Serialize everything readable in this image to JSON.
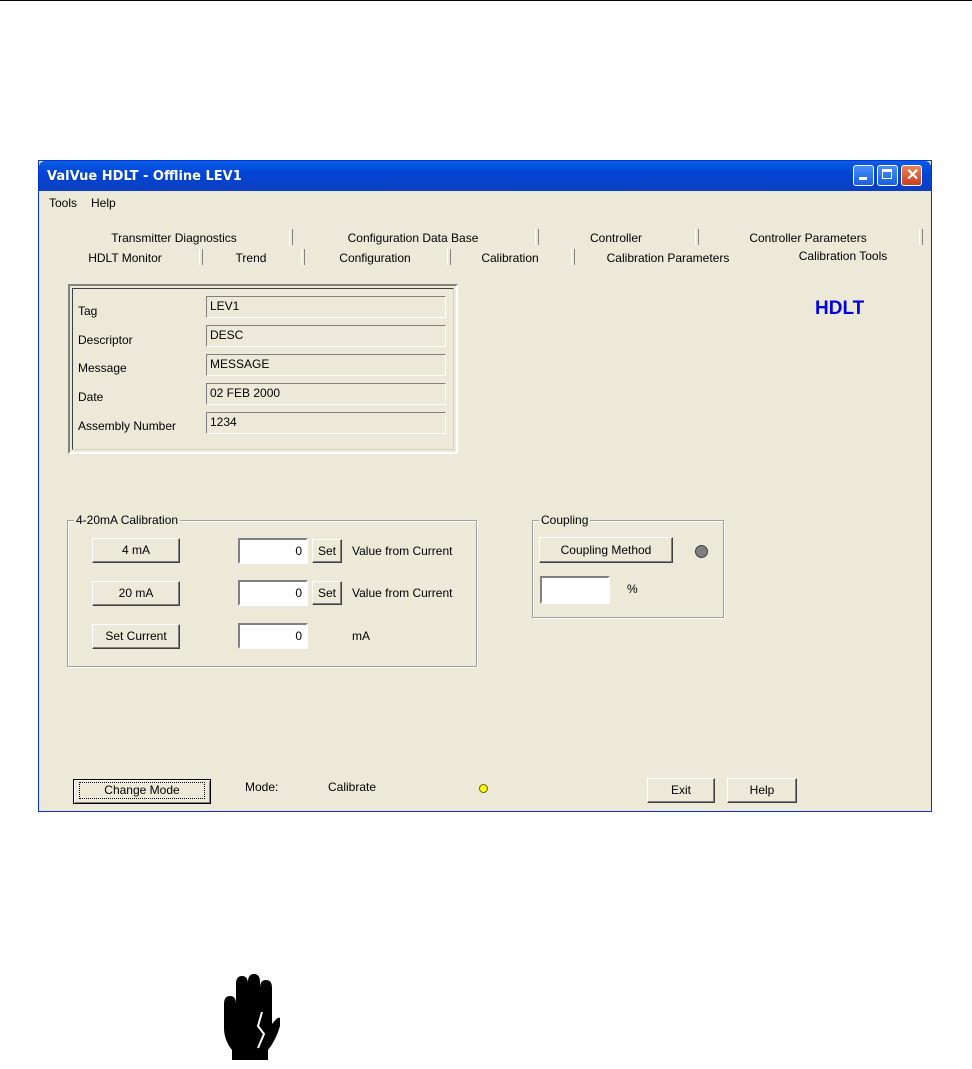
{
  "window": {
    "title": "ValVue HDLT - Offline  LEV1"
  },
  "menu": [
    "Tools",
    "Help"
  ],
  "tabs_back": [
    "Transmitter Diagnostics",
    "Configuration Data Base",
    "Controller",
    "Controller Parameters"
  ],
  "tabs_front": [
    "HDLT Monitor",
    "Trend",
    "Configuration",
    "Calibration",
    "Calibration Parameters",
    "Calibration Tools"
  ],
  "active_tab": "Calibration Tools",
  "brand": "HDLT",
  "info": {
    "rows": [
      {
        "label": "Tag",
        "value": "LEV1"
      },
      {
        "label": "Descriptor",
        "value": "DESC"
      },
      {
        "label": "Message",
        "value": "MESSAGE"
      },
      {
        "label": "Date",
        "value": "02 FEB 2000"
      },
      {
        "label": "Assembly Number",
        "value": "1234"
      }
    ]
  },
  "calibration": {
    "legend": "4-20mA Calibration",
    "btn_4ma": "4 mA",
    "btn_20ma": "20 mA",
    "btn_set_current": "Set Current",
    "val_4ma": "0",
    "val_20ma": "0",
    "val_current": "0",
    "set_label": "Set",
    "value_from_current": "Value from Current",
    "unit_ma": "mA"
  },
  "coupling": {
    "legend": "Coupling",
    "button": "Coupling Method",
    "value": "",
    "unit": "%",
    "led_color": "#808080"
  },
  "status": {
    "change_mode": "Change Mode",
    "mode_label": "Mode:",
    "mode_value": "Calibrate",
    "led_color": "#ffff00",
    "exit": "Exit",
    "help": "Help"
  },
  "colors": {
    "brand": "#0000e0",
    "window_bg": "#ece9d8",
    "title_bar": "#0245d6"
  },
  "icons": {
    "caution": "hand-stop-icon"
  }
}
